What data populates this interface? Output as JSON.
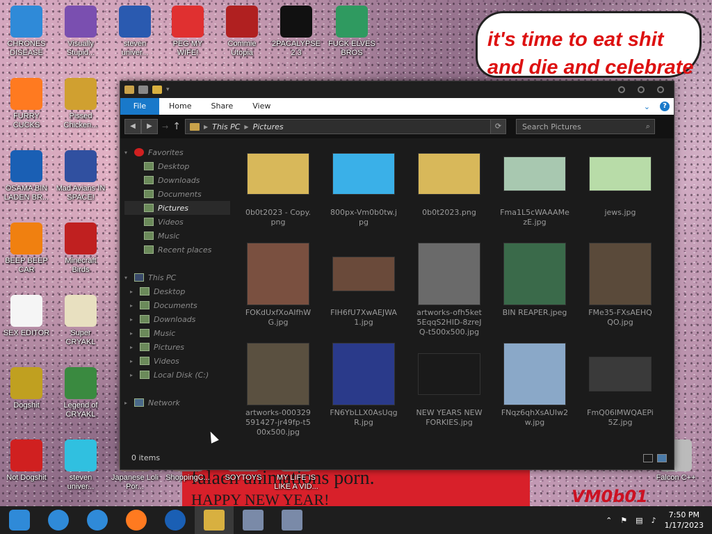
{
  "sign": {
    "line1": "it's time to eat shit",
    "line2": "and die and celebrate"
  },
  "banner": {
    "line1": "falaen animations porn.",
    "line2": "HAPPY NEW YEAR!"
  },
  "vm_text": "VM0b01",
  "desktop_icons": [
    {
      "label": "CHRONES DISEASE",
      "icon": "chrome-icon",
      "color": "#2f8ad8"
    },
    {
      "label": "Visually Stupid...",
      "icon": "visual-studio-icon",
      "color": "#7a4fb0"
    },
    {
      "label": "steven univer...",
      "icon": "steven-universe-icon",
      "color": "#2a5ab0"
    },
    {
      "label": "PEG MY WIFE!",
      "icon": "peggle-icon",
      "color": "#e03030"
    },
    {
      "label": "Commie Utopia",
      "icon": "commie-icon",
      "color": "#b02020"
    },
    {
      "label": "2PACALYPSE 2.3",
      "icon": "terminal-icon",
      "color": "#111111"
    },
    {
      "label": "FUCK ELVES BROS",
      "icon": "elves-icon",
      "color": "#2f9a60"
    },
    {
      "label": "FURRY CUCKS",
      "icon": "firefox-icon",
      "color": "#ff7a20"
    },
    {
      "label": "Pissed Chicken...",
      "icon": "angry-birds-seasons-icon",
      "color": "#d0a030"
    },
    {
      "label": "OSAMA BIN LADEN BR...",
      "icon": "obama-icon",
      "color": "#1a5fb4"
    },
    {
      "label": "Mad Avians IN SPACE!",
      "icon": "angry-birds-space-icon",
      "color": "#3050a0"
    },
    {
      "label": "BEEP BEEP CAR",
      "icon": "vlc-icon",
      "color": "#f08010"
    },
    {
      "label": "Minecraft Birds",
      "icon": "angry-birds-icon",
      "color": "#c02020"
    },
    {
      "label": "SEX EDITOR",
      "icon": "hxd-icon",
      "color": "#f5f5f5"
    },
    {
      "label": "Super CRYAKL",
      "icon": "cryakl-icon",
      "color": "#e8e0c0"
    },
    {
      "label": "Dogshit",
      "icon": "dogshit-icon",
      "color": "#c0a020"
    },
    {
      "label": "Legend of CRYAKL",
      "icon": "legend-icon",
      "color": "#3a8a40"
    },
    {
      "label": "Not Dogshit",
      "icon": "devcpp-icon",
      "color": "#d02020"
    },
    {
      "label": "steven univer...",
      "icon": "diamond-icon",
      "color": "#30c0e0"
    },
    {
      "label": "Japanese Loli Por...",
      "icon": "shortcut-icon",
      "color": "#a08080"
    },
    {
      "label": "ShoppingC...",
      "icon": "shortcut-icon",
      "color": "#a08080"
    },
    {
      "label": "SOYTOYS",
      "icon": "shortcut-icon",
      "color": "#a08080"
    },
    {
      "label": "MY LIFE IS LIKE A VID...",
      "icon": "shortcut-icon",
      "color": "#a08080"
    },
    {
      "label": "Falcon C++",
      "icon": "recycle-bin-icon",
      "color": "#bbbbbb"
    }
  ],
  "explorer": {
    "ribbon_tabs": [
      "File",
      "Home",
      "Share",
      "View"
    ],
    "breadcrumb": [
      "This PC",
      "Pictures"
    ],
    "search_placeholder": "Search Pictures",
    "favorites_header": "Favorites",
    "favorites": [
      "Desktop",
      "Downloads",
      "Documents",
      "Pictures",
      "Videos",
      "Music",
      "Recent places"
    ],
    "selected_nav": "Pictures",
    "thispc_header": "This PC",
    "thispc": [
      "Desktop",
      "Documents",
      "Downloads",
      "Music",
      "Pictures",
      "Videos",
      "Local Disk (C:)"
    ],
    "network": "Network",
    "files": [
      {
        "name": "0b0t2023 - Copy.png",
        "thumb_color": "#d8b85a"
      },
      {
        "name": "800px-Vm0b0tw.jpg",
        "thumb_color": "#3ab0e8"
      },
      {
        "name": "0b0t2023.png",
        "thumb_color": "#d8b85a"
      },
      {
        "name": "Fma1L5cWAAAMezE.jpg",
        "thumb_color": "#a8c8b0"
      },
      {
        "name": "jews.jpg",
        "thumb_color": "#b8dca8"
      },
      {
        "name": "FOKdUxfXoAIfhWG.jpg",
        "thumb_color": "#7a5040"
      },
      {
        "name": "FIH6fU7XwAEJWA1.jpg",
        "thumb_color": "#6a4a3a"
      },
      {
        "name": "artworks-ofh5ket5EqqS2HID-8zreJQ-t500x500.jpg",
        "thumb_color": "#6a6a6a"
      },
      {
        "name": "BIN REAPER.jpeg",
        "thumb_color": "#3a6a4a"
      },
      {
        "name": "FMe35-FXsAEHQQO.jpg",
        "thumb_color": "#5a4a3a"
      },
      {
        "name": "artworks-000329591427-jr49fp-t500x500.jpg",
        "thumb_color": "#5a5040"
      },
      {
        "name": "FN6YbLLX0AsUqgR.jpg",
        "thumb_color": "#2a3a8a"
      },
      {
        "name": "NEW YEARS NEW FORKIES.jpg",
        "thumb_color": "#1a1a1a"
      },
      {
        "name": "FNqz6qhXsAUIw2w.jpg",
        "thumb_color": "#8aa8c8"
      },
      {
        "name": "FmQ06lMWQAEPi5Z.jpg",
        "thumb_color": "#3a3a3a"
      }
    ],
    "status": "0 items"
  },
  "taskbar": {
    "items": [
      "chrome-icon",
      "chrome-icon",
      "firefox-icon",
      "obama-icon",
      "file-explorer-icon",
      "installer-icon",
      "installer-icon"
    ],
    "time": "7:50 PM",
    "date": "1/17/2023"
  }
}
